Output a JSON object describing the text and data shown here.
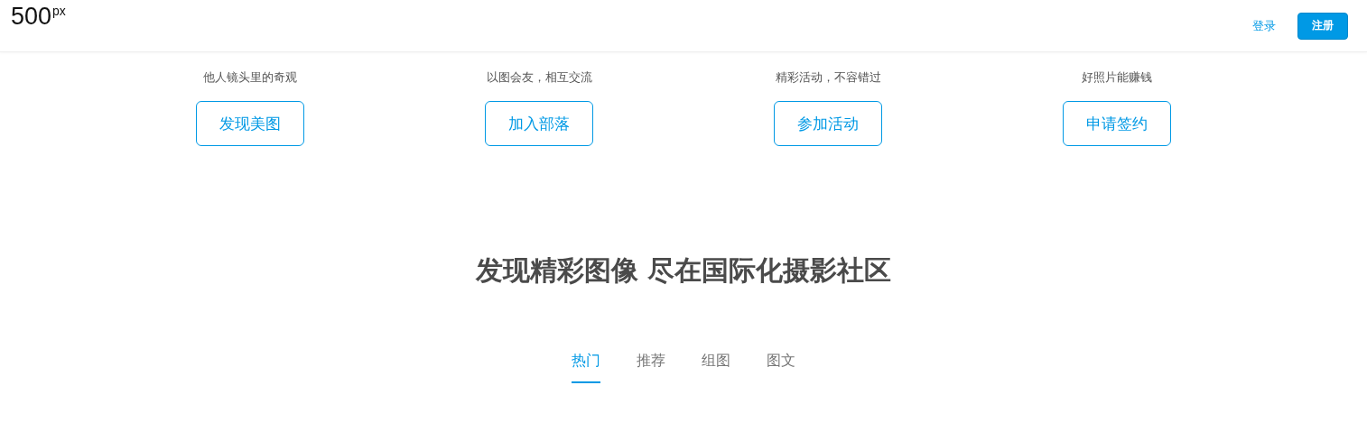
{
  "header": {
    "logo": {
      "main": "500",
      "mark": "px"
    },
    "login": "登录",
    "register": "注册"
  },
  "features": [
    {
      "subtitle": "他人镜头里的奇观",
      "button": "发现美图"
    },
    {
      "subtitle": "以图会友，相互交流",
      "button": "加入部落"
    },
    {
      "subtitle": "精彩活动，不容错过",
      "button": "参加活动"
    },
    {
      "subtitle": "好照片能赚钱",
      "button": "申请签约"
    }
  ],
  "headline": "发现精彩图像 尽在国际化摄影社区",
  "tabs": [
    {
      "label": "热门",
      "selected": true
    },
    {
      "label": "推荐",
      "selected": false
    },
    {
      "label": "组图",
      "selected": false
    },
    {
      "label": "图文",
      "selected": false
    }
  ]
}
